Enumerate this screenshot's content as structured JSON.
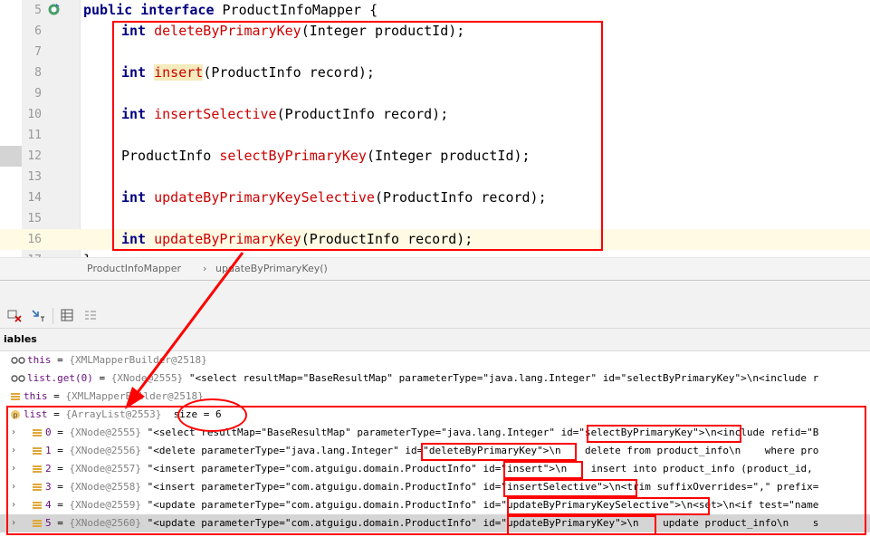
{
  "editor": {
    "lines": [
      {
        "num": "5",
        "parts": [
          {
            "t": "public interface ",
            "c": "kw"
          },
          {
            "t": "ProductInfoMapper {",
            "c": ""
          }
        ]
      },
      {
        "num": "6",
        "parts": [
          {
            "t": "int ",
            "c": "kw"
          },
          {
            "t": "deleteByPrimaryKey",
            "c": "mth"
          },
          {
            "t": "(Integer productId);",
            "c": ""
          }
        ]
      },
      {
        "num": "7",
        "parts": []
      },
      {
        "num": "8",
        "parts": [
          {
            "t": "int ",
            "c": "kw"
          },
          {
            "t": "insert",
            "c": "mth hl-insert"
          },
          {
            "t": "(ProductInfo record);",
            "c": ""
          }
        ]
      },
      {
        "num": "9",
        "parts": []
      },
      {
        "num": "10",
        "parts": [
          {
            "t": "int ",
            "c": "kw"
          },
          {
            "t": "insertSelective",
            "c": "mth"
          },
          {
            "t": "(ProductInfo record);",
            "c": ""
          }
        ]
      },
      {
        "num": "11",
        "parts": []
      },
      {
        "num": "12",
        "parts": [
          {
            "t": "ProductInfo ",
            "c": ""
          },
          {
            "t": "selectByPrimaryKey",
            "c": "mth"
          },
          {
            "t": "(Integer productId);",
            "c": ""
          }
        ]
      },
      {
        "num": "13",
        "parts": []
      },
      {
        "num": "14",
        "parts": [
          {
            "t": "int ",
            "c": "kw"
          },
          {
            "t": "updateByPrimaryKeySelective",
            "c": "mth"
          },
          {
            "t": "(ProductInfo record);",
            "c": ""
          }
        ]
      },
      {
        "num": "15",
        "parts": []
      },
      {
        "num": "16",
        "parts": [
          {
            "t": "int ",
            "c": "kw"
          },
          {
            "t": "updateByPrimaryKey",
            "c": "mth"
          },
          {
            "t": "(ProductInfo record);",
            "c": ""
          }
        ]
      },
      {
        "num": "17",
        "parts": [
          {
            "t": "}",
            "c": ""
          }
        ]
      }
    ]
  },
  "breadcrumb": {
    "class_name": "ProductInfoMapper",
    "separator": "›",
    "method": "updateByPrimaryKey()"
  },
  "debug": {
    "panel_title": "iables"
  },
  "variables": [
    {
      "icon": "watch-icon",
      "name": "this",
      "eq": " = ",
      "ref": "{XMLMapperBuilder@2518}",
      "val": ""
    },
    {
      "icon": "watch-icon",
      "name": "list.get(0)",
      "eq": " = ",
      "ref": "{XNode@2555}",
      "val": " \"<select resultMap=\"BaseResultMap\" parameterType=\"java.lang.Integer\" id=\"selectByPrimaryKey\">\\n<include r"
    },
    {
      "icon": "field-icon",
      "name": "this",
      "eq": " = ",
      "ref": "{XMLMapperBuilder@2518}",
      "val": ""
    },
    {
      "icon": "param-icon",
      "name": "list",
      "eq": " = ",
      "ref": "{ArrayList@2553}",
      "val": "  size = 6"
    },
    {
      "icon": "field-icon",
      "name": "0",
      "eq": " = ",
      "ref": "{XNode@2555}",
      "val": " \"<select resultMap=\"BaseResultMap\" parameterType=\"java.lang.Integer\" id=\"selectByPrimaryKey\">\\n<include refid=\"B"
    },
    {
      "icon": "field-icon",
      "name": "1",
      "eq": " = ",
      "ref": "{XNode@2556}",
      "val": " \"<delete parameterType=\"java.lang.Integer\" id=\"deleteByPrimaryKey\">\\n    delete from product_info\\n    where pro"
    },
    {
      "icon": "field-icon",
      "name": "2",
      "eq": " = ",
      "ref": "{XNode@2557}",
      "val": " \"<insert parameterType=\"com.atguigu.domain.ProductInfo\" id=\"insert\">\\n    insert into product_info (product_id,"
    },
    {
      "icon": "field-icon",
      "name": "3",
      "eq": " = ",
      "ref": "{XNode@2558}",
      "val": " \"<insert parameterType=\"com.atguigu.domain.ProductInfo\" id=\"insertSelective\">\\n<trim suffixOverrides=\",\" prefix="
    },
    {
      "icon": "field-icon",
      "name": "4",
      "eq": " = ",
      "ref": "{XNode@2559}",
      "val": " \"<update parameterType=\"com.atguigu.domain.ProductInfo\" id=\"updateByPrimaryKeySelective\">\\n<set>\\n<if test=\"name"
    },
    {
      "icon": "field-icon",
      "name": "5",
      "eq": " = ",
      "ref": "{XNode@2560}",
      "val": " \"<update parameterType=\"com.atguigu.domain.ProductInfo\" id=\"updateByPrimaryKey\">\\n    update product_info\\n    s"
    }
  ],
  "colors": {
    "annotation": "#ff0000",
    "keyword": "#000080",
    "method": "#cc0000"
  }
}
